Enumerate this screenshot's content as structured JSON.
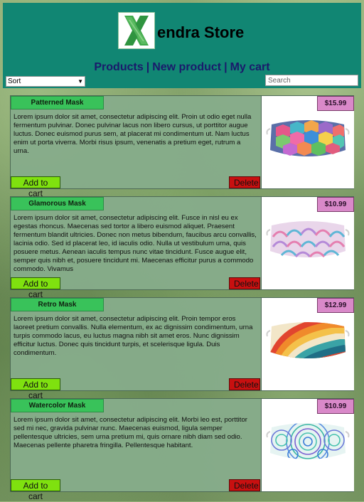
{
  "store": {
    "logo_letter": "X",
    "brand_rest": "endra Store"
  },
  "nav": {
    "products": "Products",
    "new_product": "New product",
    "my_cart": "My cart",
    "separator": "|"
  },
  "controls": {
    "sort_value": "Sort",
    "search_placeholder": "Search"
  },
  "products": [
    {
      "name": "Patterned Mask",
      "price": "$15.99",
      "description": "Lorem ipsum dolor sit amet, consectetur adipiscing elit. Proin ut odio eget nulla fermentum pulvinar. Donec pulvinar lacus non libero cursus, ut porttitor augue luctus. Donec euismod purus sem, at placerat mi condimentum ut. Nam luctus enim ut porta viverra. Morbi risus ipsum, venenatis a pretium eget, rutrum a urna.",
      "add_label": "Add to cart",
      "delete_label": "Delete",
      "image_icon": "hexagon-pattern-mask-image"
    },
    {
      "name": "Glamorous Mask",
      "price": "$10.99",
      "description": "Lorem ipsum dolor sit amet, consectetur adipiscing elit. Fusce in nisl eu ex egestas rhoncus. Maecenas sed tortor a libero euismod aliquet. Praesent fermentum blandit ultricies. Donec non metus bibendum, faucibus arcu convallis, lacinia odio. Sed id placerat leo, id iaculis odio. Nulla ut vestibulum urna, quis posuere metus. Aenean iaculis tempus nunc vitae tincidunt. Fusce augue elit, semper quis nibh et, posuere tincidunt mi. Maecenas efficitur purus a commodo commodo. Vivamus",
      "add_label": "Add to cart",
      "delete_label": "Delete",
      "image_icon": "scallop-pattern-mask-image"
    },
    {
      "name": "Retro Mask",
      "price": "$12.99",
      "description": "Lorem ipsum dolor sit amet, consectetur adipiscing elit. Proin tempor eros laoreet pretium convallis. Nulla elementum, ex ac dignissim condimentum, urna turpis commodo lacus, eu luctus magna nibh sit amet eros. Nunc dignissim efficitur luctus. Donec quis tincidunt turpis, et scelerisque ligula. Duis condimentum.",
      "add_label": "Add to cart",
      "delete_label": "Delete",
      "image_icon": "retro-wave-mask-image"
    },
    {
      "name": "Watercolor Mask",
      "price": "$10.99",
      "description": "Lorem ipsum dolor sit amet, consectetur adipiscing elit. Morbi leo est, porttitor sed mi nec, gravida pulvinar nunc. Maecenas euismod, ligula semper pellentesque ultricies, sem urna pretium mi, quis ornare nibh diam sed odio. Maecenas pellente pharetra fringilla. Pellentesque habitant.",
      "add_label": "Add to cart",
      "delete_label": "Delete",
      "image_icon": "watercolor-mandala-mask-image"
    }
  ],
  "colors": {
    "header_bg": "#118673",
    "nav_text": "#1a1a6b",
    "name_tag": "#39c25a",
    "price_tag": "#d989c9",
    "add_button": "#7fe10f",
    "delete_button": "#c81010",
    "card_bg": "#86ac8a"
  }
}
